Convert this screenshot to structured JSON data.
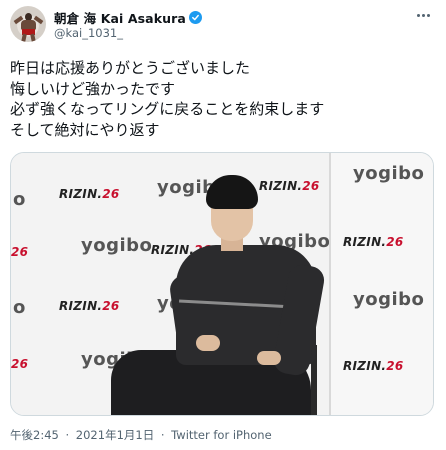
{
  "header": {
    "display_name": "朝倉 海 Kai Asakura",
    "handle": "@kai_1031_",
    "verified": true,
    "avatar_icon": "fighter-avatar"
  },
  "tweet": {
    "lines": [
      "昨日は応援ありがとうございました",
      "悔しいけど強かったです",
      "必ず強くなってリングに戻ることを約束します",
      "そして絶対にやり返す"
    ]
  },
  "media": {
    "logos": {
      "yogibo": "yogibo",
      "rizin_prefix": "RIZIN.",
      "rizin_number": "26"
    }
  },
  "footer": {
    "time": "午後2:45",
    "date": "2021年1月1日",
    "separator": "·",
    "source": "Twitter for iPhone"
  },
  "colors": {
    "verified": "#1d9bf0",
    "secondary_text": "#536471",
    "border": "#cfd9de"
  }
}
